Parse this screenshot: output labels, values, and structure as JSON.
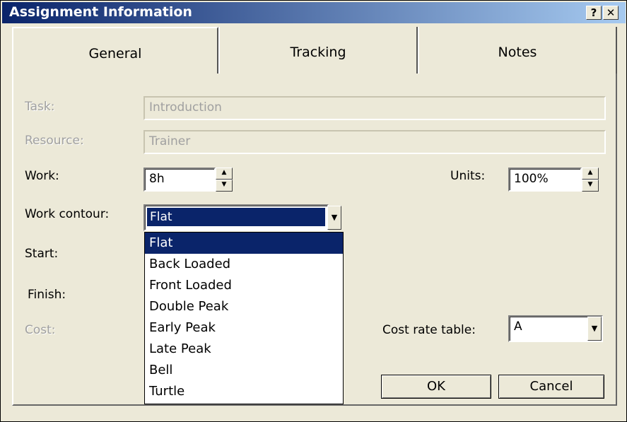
{
  "window": {
    "title": "Assignment Information",
    "help_button": "?",
    "close_button": "✕"
  },
  "tabs": [
    {
      "label": "General",
      "active": true
    },
    {
      "label": "Tracking",
      "active": false
    },
    {
      "label": "Notes",
      "active": false
    }
  ],
  "form": {
    "task": {
      "label": "Task:",
      "value": "Introduction",
      "enabled": false
    },
    "resource": {
      "label": "Resource:",
      "value": "Trainer",
      "enabled": false
    },
    "work": {
      "label": "Work:",
      "value": "8h"
    },
    "units": {
      "label": "Units:",
      "value": "100%"
    },
    "work_contour": {
      "label": "Work contour:",
      "value": "Flat"
    },
    "start": {
      "label": "Start:"
    },
    "finish": {
      "label": "Finish:"
    },
    "cost": {
      "label": "Cost:",
      "enabled": false
    },
    "cost_rate_table": {
      "label": "Cost rate table:",
      "value": "A"
    }
  },
  "contour_options": [
    "Flat",
    "Back Loaded",
    "Front Loaded",
    "Double Peak",
    "Early Peak",
    "Late Peak",
    "Bell",
    "Turtle"
  ],
  "buttons": {
    "ok": "OK",
    "cancel": "Cancel"
  }
}
